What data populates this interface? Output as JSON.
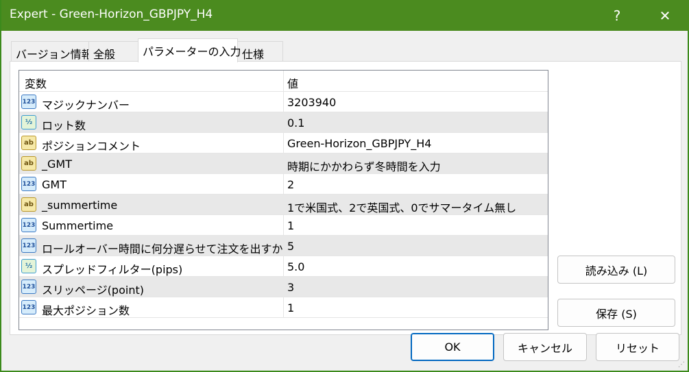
{
  "window": {
    "title": "Expert - Green-Horizon_GBPJPY_H4",
    "help_label": "?",
    "close_label": "✕"
  },
  "tabs": [
    {
      "label": "バージョン情報"
    },
    {
      "label": "全般"
    },
    {
      "label": "パラメーターの入力"
    },
    {
      "label": "仕様"
    }
  ],
  "grid": {
    "headers": {
      "variable": "変数",
      "value": "値"
    },
    "rows": [
      {
        "type_icon": "int-icon",
        "icon_text": "123",
        "name": "マジックナンバー",
        "value": "3203940"
      },
      {
        "type_icon": "double-icon",
        "icon_text": "½",
        "name": "ロット数",
        "value": "0.1"
      },
      {
        "type_icon": "string-icon",
        "icon_text": "ab",
        "name": "ポジションコメント",
        "value": "Green-Horizon_GBPJPY_H4"
      },
      {
        "type_icon": "string-icon",
        "icon_text": "ab",
        "name": "_GMT",
        "value": "時期にかかわらず冬時間を入力"
      },
      {
        "type_icon": "int-icon",
        "icon_text": "123",
        "name": "GMT",
        "value": "2"
      },
      {
        "type_icon": "string-icon",
        "icon_text": "ab",
        "name": "_summertime",
        "value": "1で米国式、2で英国式、0でサマータイム無し"
      },
      {
        "type_icon": "int-icon",
        "icon_text": "123",
        "name": "Summertime",
        "value": "1"
      },
      {
        "type_icon": "int-icon",
        "icon_text": "123",
        "name": "ロールオーバー時間に何分遅らせて注文を出すか",
        "value": "5"
      },
      {
        "type_icon": "double-icon",
        "icon_text": "½",
        "name": "スプレッドフィルター(pips)",
        "value": "5.0"
      },
      {
        "type_icon": "int-icon",
        "icon_text": "123",
        "name": "スリッページ(point)",
        "value": "3"
      },
      {
        "type_icon": "int-icon",
        "icon_text": "123",
        "name": "最大ポジション数",
        "value": "1"
      }
    ]
  },
  "buttons": {
    "load": "読み込み (L)",
    "save": "保存 (S)",
    "ok": "OK",
    "cancel": "キャンセル",
    "reset": "リセット"
  },
  "colors": {
    "titlebar": "#4b8b1f",
    "row_alt": "#e8e8e8",
    "primary_border": "#0067c0"
  }
}
